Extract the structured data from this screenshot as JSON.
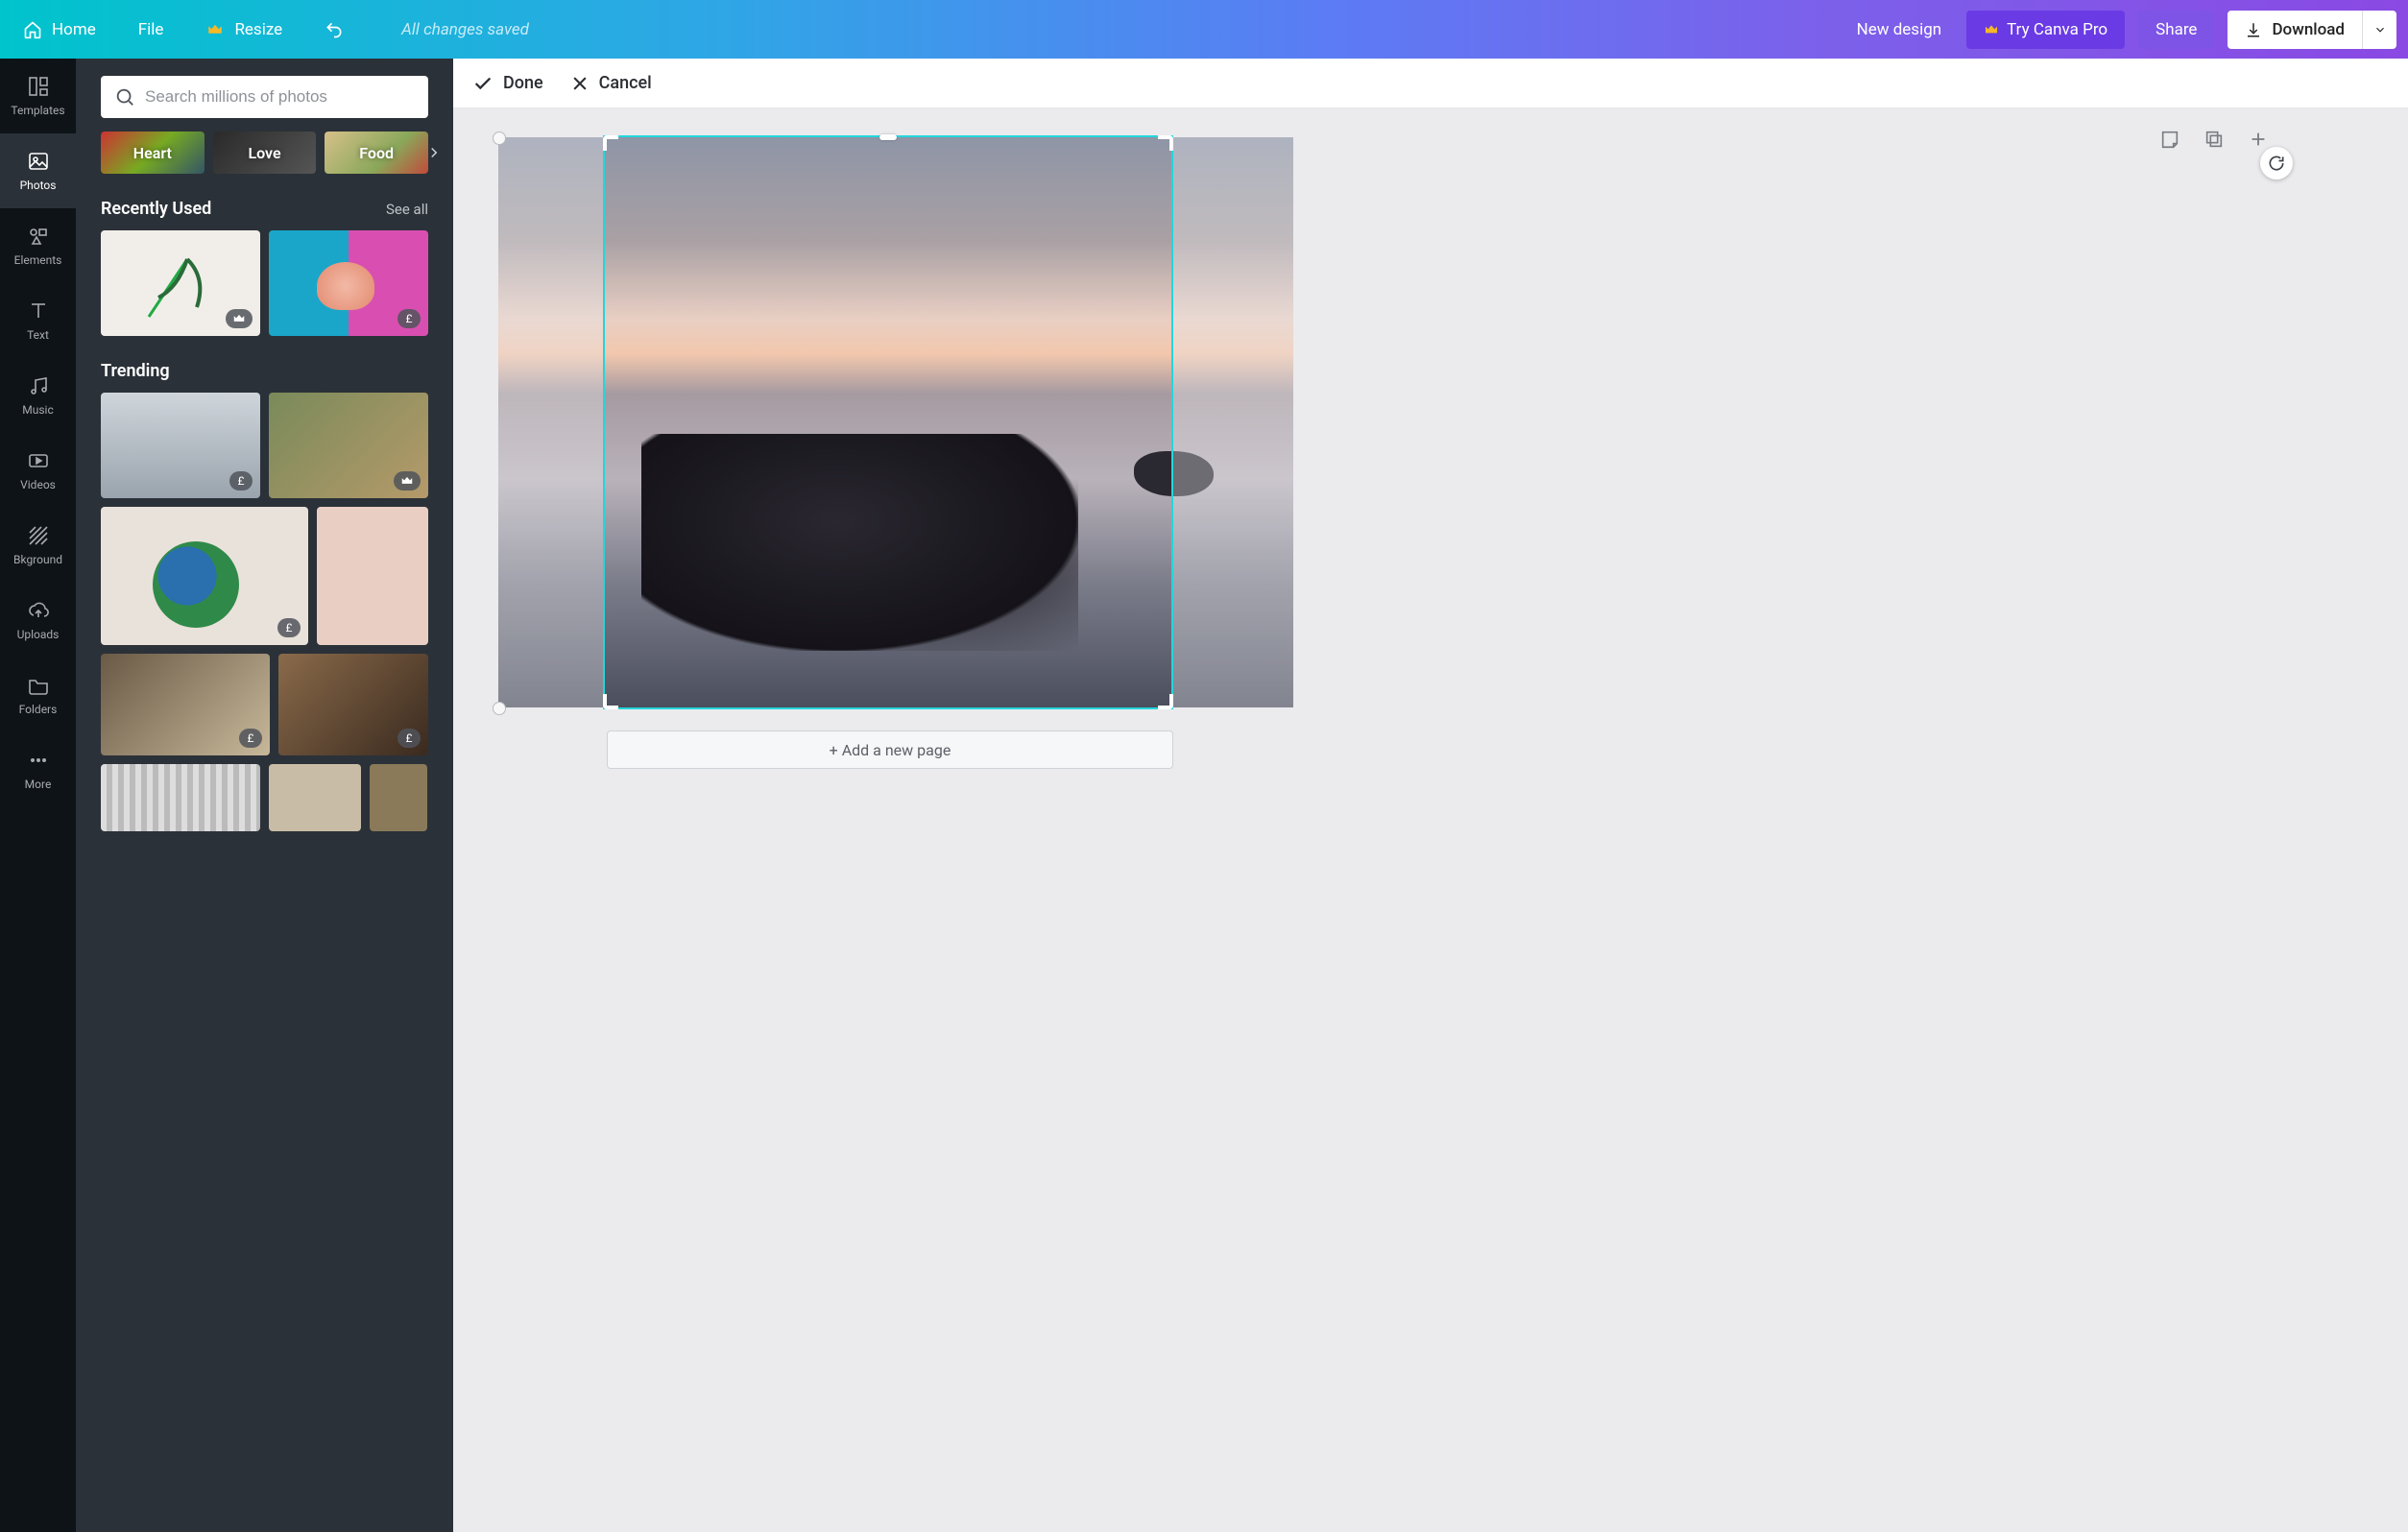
{
  "topbar": {
    "home": "Home",
    "file": "File",
    "resize": "Resize",
    "status": "All changes saved",
    "new_design": "New design",
    "try_pro": "Try Canva Pro",
    "share": "Share",
    "download": "Download"
  },
  "rail": {
    "templates": "Templates",
    "photos": "Photos",
    "elements": "Elements",
    "text": "Text",
    "music": "Music",
    "videos": "Videos",
    "bkground": "Bkground",
    "uploads": "Uploads",
    "folders": "Folders",
    "more": "More"
  },
  "panel": {
    "search_placeholder": "Search millions of photos",
    "chips": {
      "heart": "Heart",
      "love": "Love",
      "food": "Food"
    },
    "recently_used": "Recently Used",
    "see_all": "See all",
    "trending": "Trending",
    "price_badge": "£"
  },
  "cropbar": {
    "done": "Done",
    "cancel": "Cancel"
  },
  "canvas": {
    "add_page": "+ Add a new page"
  }
}
